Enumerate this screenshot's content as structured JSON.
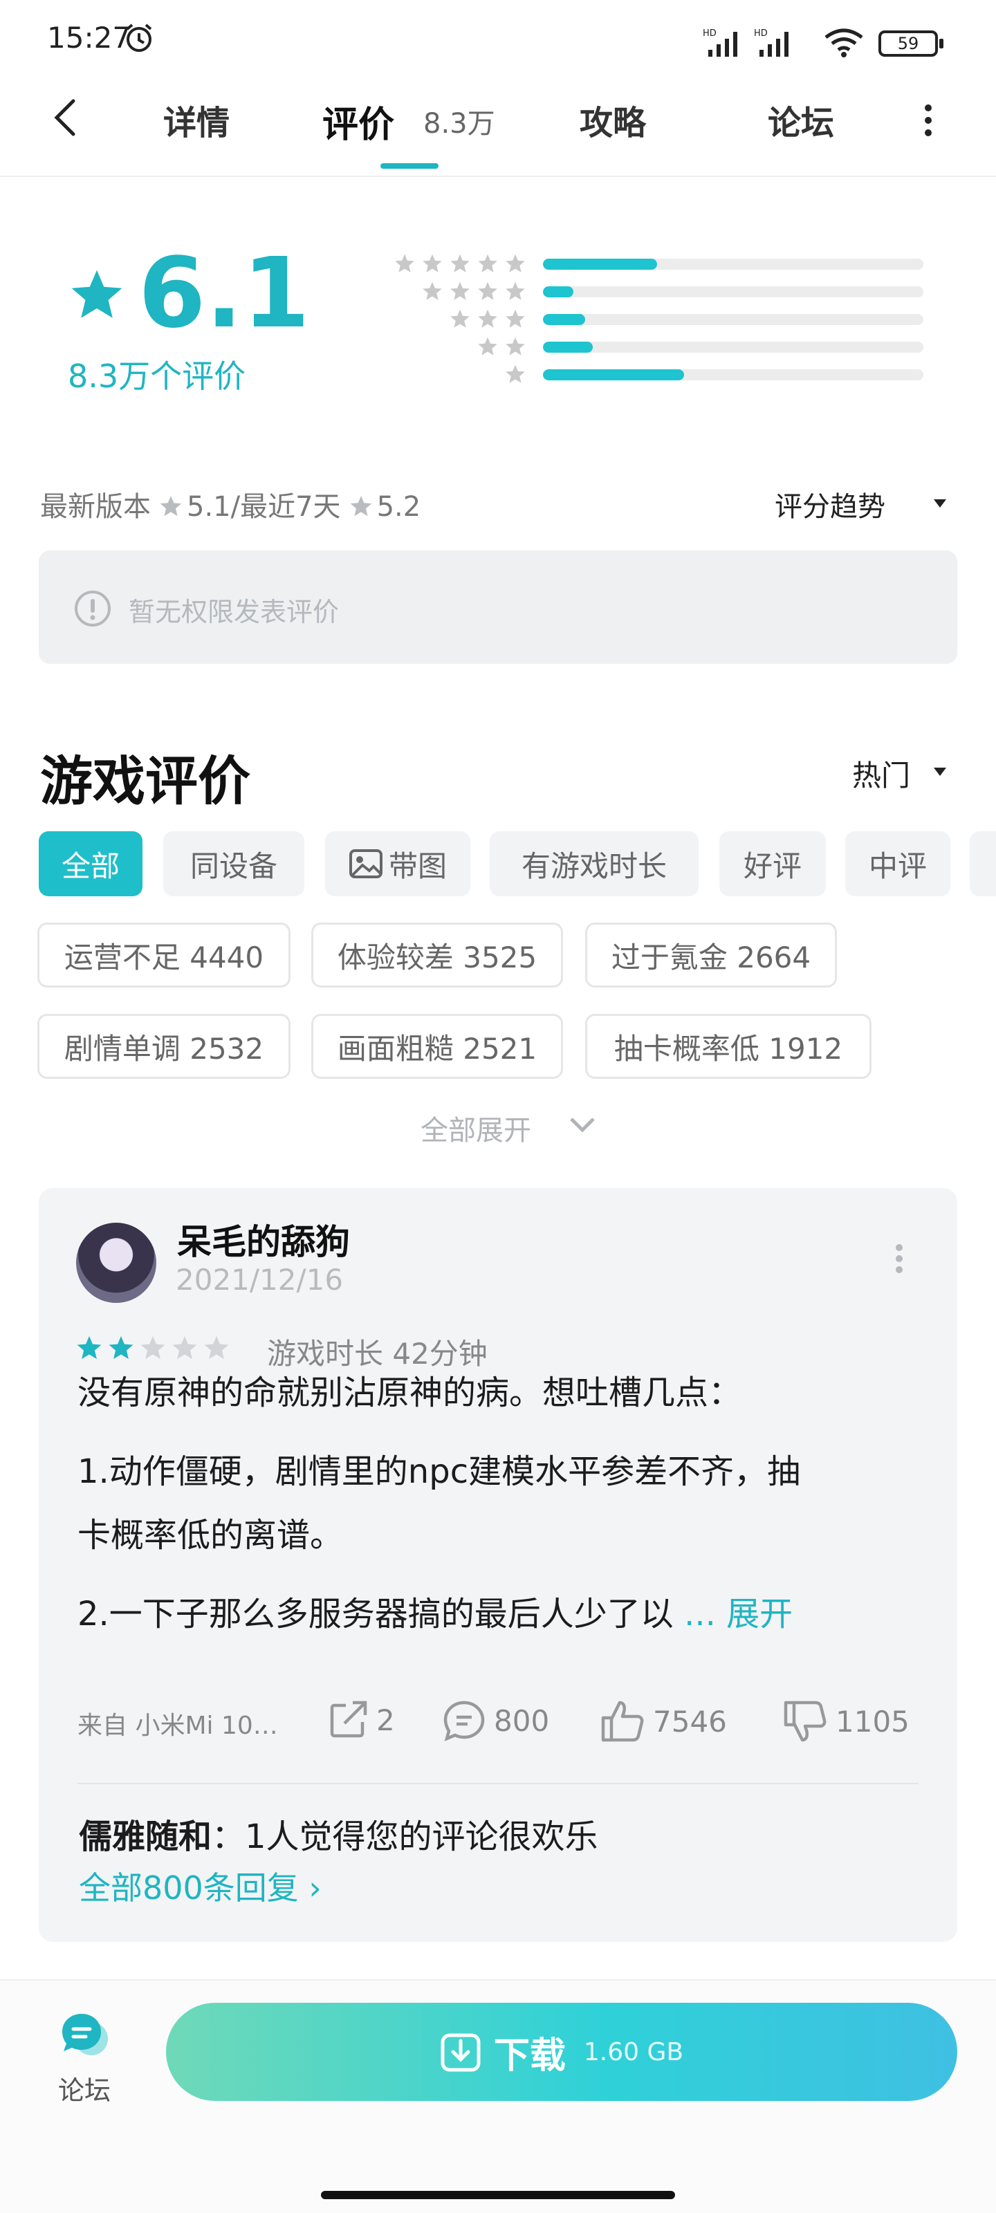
{
  "status_bar": {
    "time": "15:27",
    "battery": "59",
    "network_labels": [
      "HD",
      "HD"
    ]
  },
  "nav": {
    "tabs": [
      {
        "label": "详情"
      },
      {
        "label": "评价",
        "count": "8.3万"
      },
      {
        "label": "攻略"
      },
      {
        "label": "论坛"
      }
    ]
  },
  "rating": {
    "score": "6.1",
    "count_text": "8.3万个评价",
    "distribution": [
      {
        "stars": 5,
        "fraction": 0.3
      },
      {
        "stars": 4,
        "fraction": 0.08
      },
      {
        "stars": 3,
        "fraction": 0.11
      },
      {
        "stars": 2,
        "fraction": 0.13
      },
      {
        "stars": 1,
        "fraction": 0.37
      }
    ],
    "latest_label": "最新版本",
    "latest_score": "5.1",
    "recent_label": "/最近7天",
    "recent_score": "5.2",
    "trend_label": "评分趋势"
  },
  "notice": {
    "text": "暂无权限发表评价"
  },
  "reviews_section": {
    "title": "游戏评价",
    "sort": "热门",
    "filters": [
      "全部",
      "同设备",
      "带图",
      "有游戏时长",
      "好评",
      "中评"
    ],
    "tags": [
      [
        "运营不足 4440",
        "体验较差 3525",
        "过于氪金 2664"
      ],
      [
        "剧情单调 2532",
        "画面粗糙 2521",
        "抽卡概率低 1912"
      ]
    ],
    "expand_all": "全部展开"
  },
  "review": {
    "username": "呆毛的舔狗",
    "date": "2021/12/16",
    "stars": 2,
    "playtime": "游戏时长 42分钟",
    "lines": [
      "没有原神的命就别沾原神的病。想吐槽几点：",
      "1.动作僵硬，剧情里的npc建模水平参差不齐，抽",
      "卡概率低的离谱。",
      "2.一下子那么多服务器搞的最后人少了以"
    ],
    "expand": "... 展开",
    "device": "来自 小米Mi 10…",
    "share_count": "2",
    "comment_count": "800",
    "like_count": "7546",
    "dislike_count": "1105",
    "reply_user": "儒雅随和",
    "reply_text": "：1人觉得您的评论很欢乐",
    "all_replies": "全部800条回复 ›"
  },
  "bottom_bar": {
    "forum_label": "论坛",
    "download_label": "下载",
    "download_size": "1.60 GB"
  },
  "colors": {
    "accent": "#1fb5c2",
    "star_gray": "#c8c8c8"
  }
}
